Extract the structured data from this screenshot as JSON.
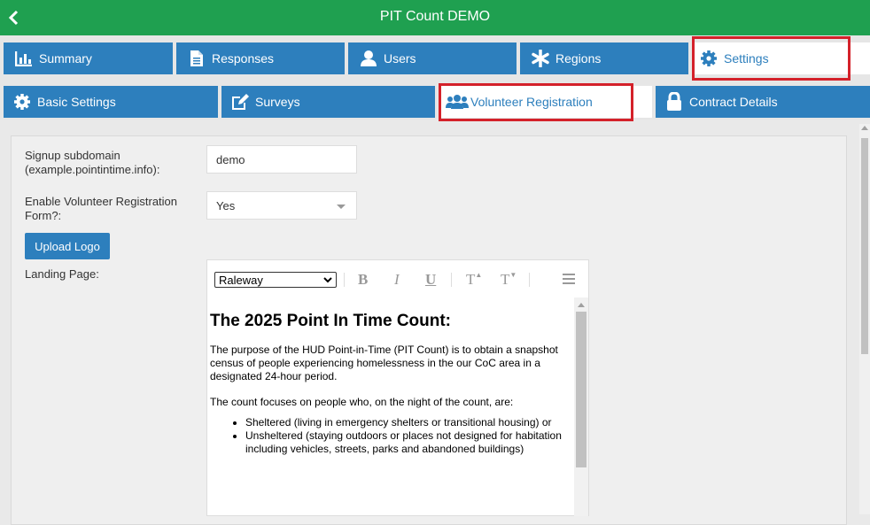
{
  "header": {
    "title": "PIT Count DEMO",
    "back_icon": "chevron-left-icon"
  },
  "main_tabs": [
    {
      "label": "Summary",
      "icon": "bar-chart-icon"
    },
    {
      "label": "Responses",
      "icon": "document-icon"
    },
    {
      "label": "Users",
      "icon": "user-icon"
    },
    {
      "label": "Regions",
      "icon": "asterisk-icon"
    },
    {
      "label": "Settings",
      "icon": "gear-icon",
      "active": true
    }
  ],
  "settings_tabs": [
    {
      "label": "Basic Settings",
      "icon": "gear-icon"
    },
    {
      "label": "Surveys",
      "icon": "edit-icon"
    },
    {
      "label": "Volunteer Registration",
      "icon": "users-icon",
      "active": true
    },
    {
      "label": "Contract Details",
      "icon": "lock-icon"
    }
  ],
  "form": {
    "subdomain_label_1": "Signup subdomain",
    "subdomain_label_2": "(example.pointintime.info):",
    "subdomain_value": "demo",
    "enable_label_1": "Enable Volunteer Registration",
    "enable_label_2": "Form?:",
    "enable_value": "Yes",
    "upload_logo": "Upload Logo",
    "landing_label": "Landing Page:"
  },
  "editor": {
    "font": "Raleway",
    "heading": "The 2025 Point In Time Count:",
    "para1": "The purpose of the HUD Point-in-Time (PIT Count) is to obtain a snapshot census of people experiencing homelessness in the our CoC area in a designated 24-hour period.",
    "para2": "The count focuses on people who, on the night of the count, are:",
    "bullets": [
      "Sheltered (living in emergency shelters or transitional housing) or",
      "Unsheltered (staying outdoors or places not designed for habitation including vehicles, streets, parks and abandoned buildings)"
    ],
    "tools": {
      "bold": "B",
      "italic": "I",
      "underline": "U",
      "superscript": "T",
      "subscript": "T"
    }
  },
  "colors": {
    "header": "#1fa050",
    "tab": "#2d7fbd",
    "highlight": "#d4212a"
  }
}
